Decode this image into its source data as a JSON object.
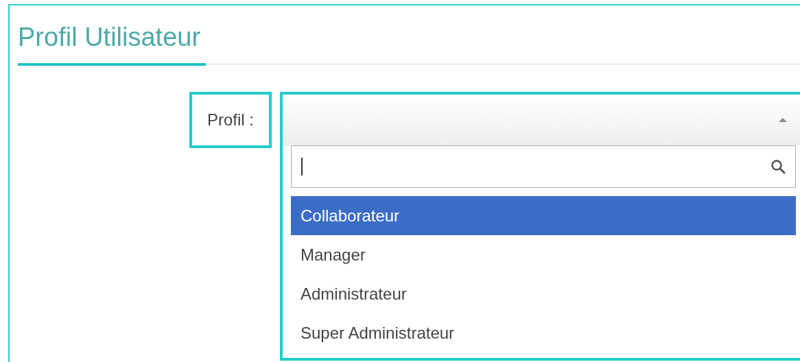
{
  "title": "Profil Utilisateur",
  "field": {
    "label": "Profil :"
  },
  "dropdown": {
    "expanded": true,
    "options": [
      {
        "label": "Collaborateur",
        "selected": true
      },
      {
        "label": "Manager",
        "selected": false
      },
      {
        "label": "Administrateur",
        "selected": false
      },
      {
        "label": "Super Administrateur",
        "selected": false
      }
    ]
  }
}
